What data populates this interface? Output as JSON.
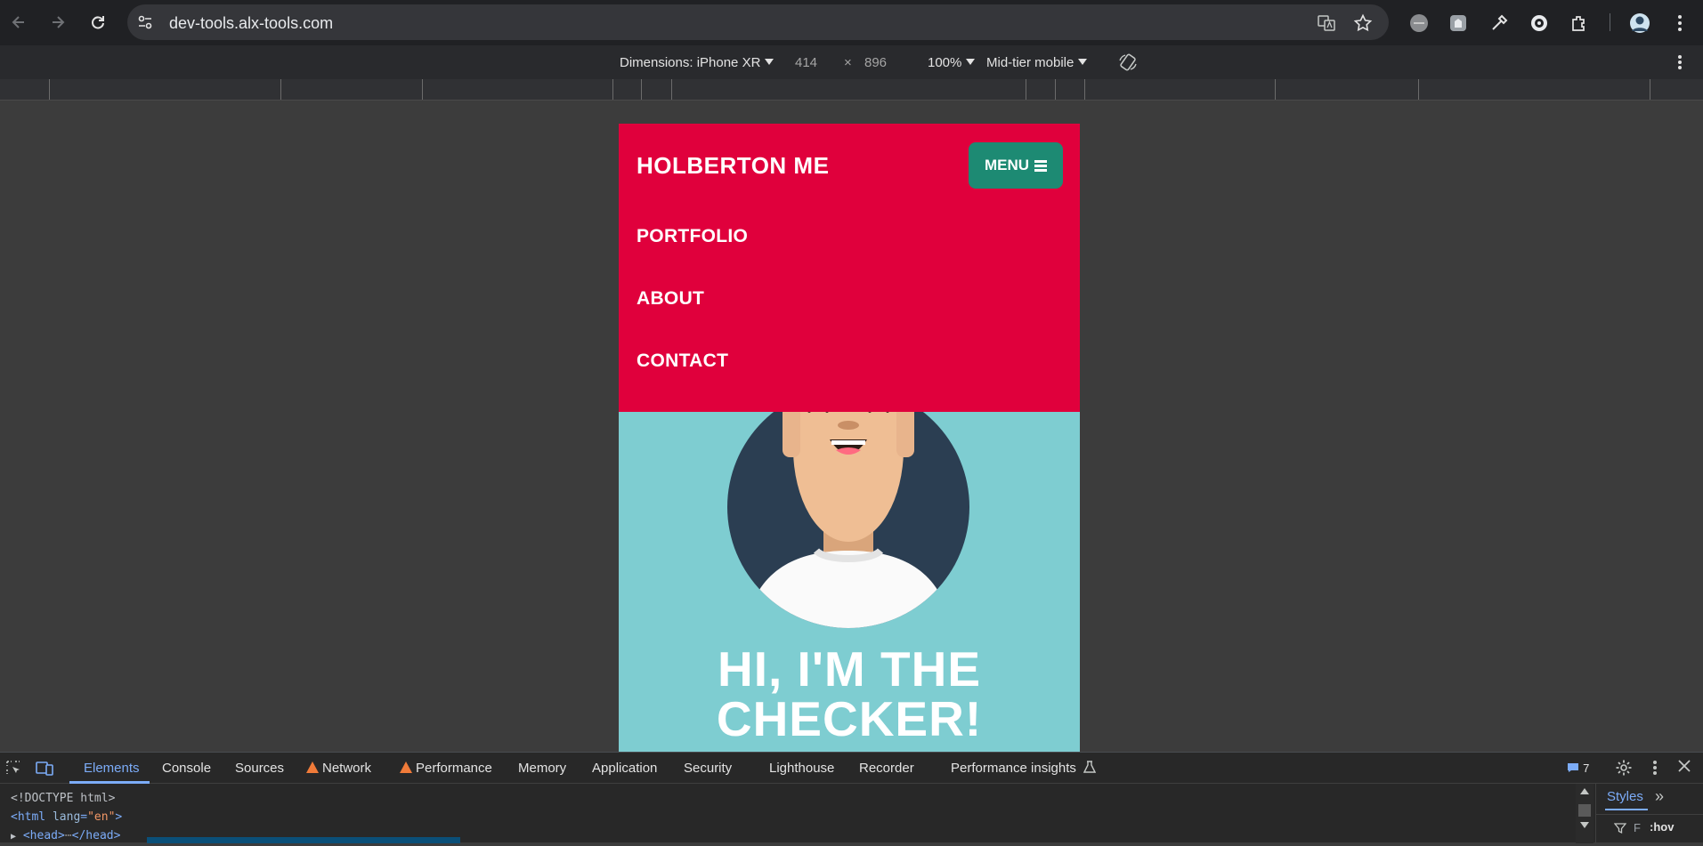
{
  "browser": {
    "url": "dev-tools.alx-tools.com"
  },
  "device_toolbar": {
    "dimensions_label": "Dimensions: iPhone XR",
    "width": "414",
    "times": "×",
    "height": "896",
    "zoom": "100%",
    "throttling": "Mid-tier mobile"
  },
  "site": {
    "brand": "HOLBERTON ME",
    "menu_label": "MENU",
    "nav": [
      "PORTFOLIO",
      "ABOUT",
      "CONTACT"
    ],
    "hero_line1": "HI, I'M THE",
    "hero_line2": "CHECKER!",
    "colors": {
      "header": "#e0003c",
      "menu_button": "#1d8a73",
      "hero_bg": "#7ecdd1"
    }
  },
  "devtools": {
    "tabs": [
      "Elements",
      "Console",
      "Sources",
      "Network",
      "Performance",
      "Memory",
      "Application",
      "Security",
      "Lighthouse",
      "Recorder",
      "Performance insights"
    ],
    "issues_count": "7",
    "code_line1": "<!DOCTYPE html>",
    "code_tag_open": "<html ",
    "code_attr": "lang",
    "code_eq": "=",
    "code_val": "\"en\"",
    "code_tag_close": ">",
    "code_line3": "<head>",
    "code_line3_end": "</head>",
    "styles_tab": "Styles",
    "filter_label": "F",
    "hov_label": ":hov"
  }
}
